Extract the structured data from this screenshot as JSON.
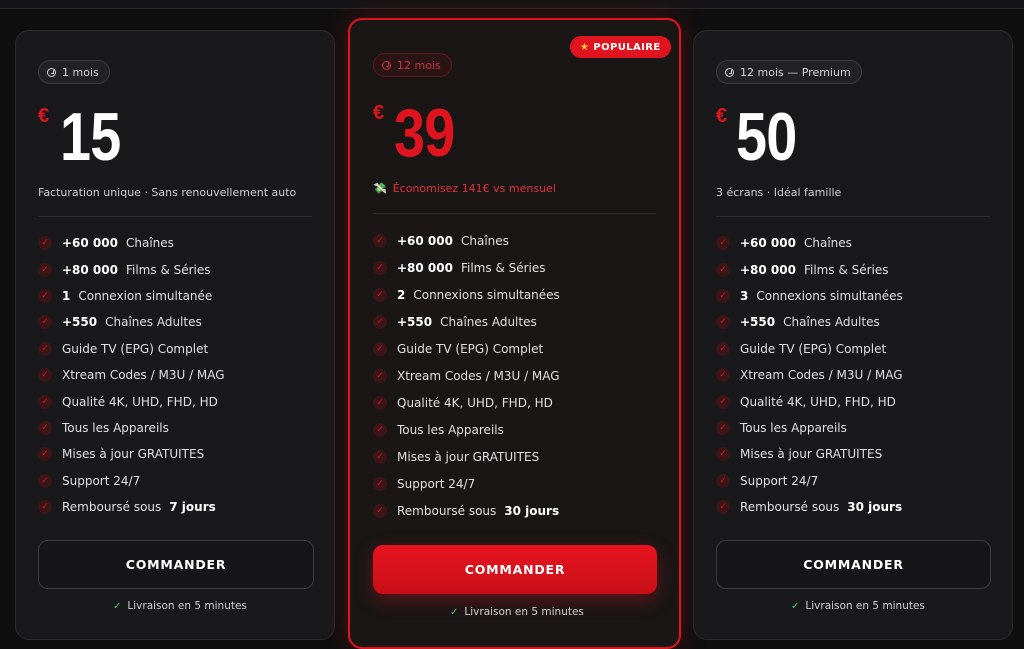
{
  "colors": {
    "accent": "#e0141e",
    "background": "#0f0f10",
    "card": "#19191b",
    "check_green": "#3ec46d"
  },
  "icons": {
    "duration": "clock-icon",
    "feature": "check-circle-icon",
    "popular": "star-icon",
    "savings": "money-icon",
    "delivery": "check-icon"
  },
  "plans": [
    {
      "duration": "1 mois",
      "currency": "€",
      "price": "15",
      "subtitle": "Facturation unique · Sans renouvellement auto",
      "features": [
        {
          "num": "+60 000",
          "text": "Chaînes"
        },
        {
          "num": "+80 000",
          "text": "Films & Séries"
        },
        {
          "num": "1",
          "text": "Connexion simultanée"
        },
        {
          "num": "+550",
          "text": "Chaînes Adultes"
        },
        {
          "text": "Guide TV (EPG) Complet"
        },
        {
          "text": "Xtream Codes / M3U / MAG"
        },
        {
          "text": "Qualité 4K, UHD, FHD, HD"
        },
        {
          "text": "Tous les Appareils"
        },
        {
          "text": "Mises à jour GRATUITES"
        },
        {
          "text": "Support 24/7"
        },
        {
          "text": "Remboursé sous",
          "strong": "7 jours"
        }
      ],
      "cta": "COMMANDER",
      "delivery": "Livraison en 5 minutes"
    },
    {
      "badge": "POPULAIRE",
      "duration": "12 mois",
      "currency": "€",
      "price": "39",
      "subtitle": "Économisez 141€ vs mensuel",
      "features": [
        {
          "num": "+60 000",
          "text": "Chaînes"
        },
        {
          "num": "+80 000",
          "text": "Films & Séries"
        },
        {
          "num": "2",
          "text": "Connexions simultanées"
        },
        {
          "num": "+550",
          "text": "Chaînes Adultes"
        },
        {
          "text": "Guide TV (EPG) Complet"
        },
        {
          "text": "Xtream Codes / M3U / MAG"
        },
        {
          "text": "Qualité 4K, UHD, FHD, HD"
        },
        {
          "text": "Tous les Appareils"
        },
        {
          "text": "Mises à jour GRATUITES"
        },
        {
          "text": "Support 24/7"
        },
        {
          "text": "Remboursé sous",
          "strong": "30 jours"
        }
      ],
      "cta": "COMMANDER",
      "delivery": "Livraison en 5 minutes"
    },
    {
      "duration": "12 mois — Premium",
      "currency": "€",
      "price": "50",
      "subtitle": "3 écrans · Idéal famille",
      "features": [
        {
          "num": "+60 000",
          "text": "Chaînes"
        },
        {
          "num": "+80 000",
          "text": "Films & Séries"
        },
        {
          "num": "3",
          "text": "Connexions simultanées"
        },
        {
          "num": "+550",
          "text": "Chaînes Adultes"
        },
        {
          "text": "Guide TV (EPG) Complet"
        },
        {
          "text": "Xtream Codes / M3U / MAG"
        },
        {
          "text": "Qualité 4K, UHD, FHD, HD"
        },
        {
          "text": "Tous les Appareils"
        },
        {
          "text": "Mises à jour GRATUITES"
        },
        {
          "text": "Support 24/7"
        },
        {
          "text": "Remboursé sous",
          "strong": "30 jours"
        }
      ],
      "cta": "COMMANDER",
      "delivery": "Livraison en 5 minutes"
    }
  ]
}
